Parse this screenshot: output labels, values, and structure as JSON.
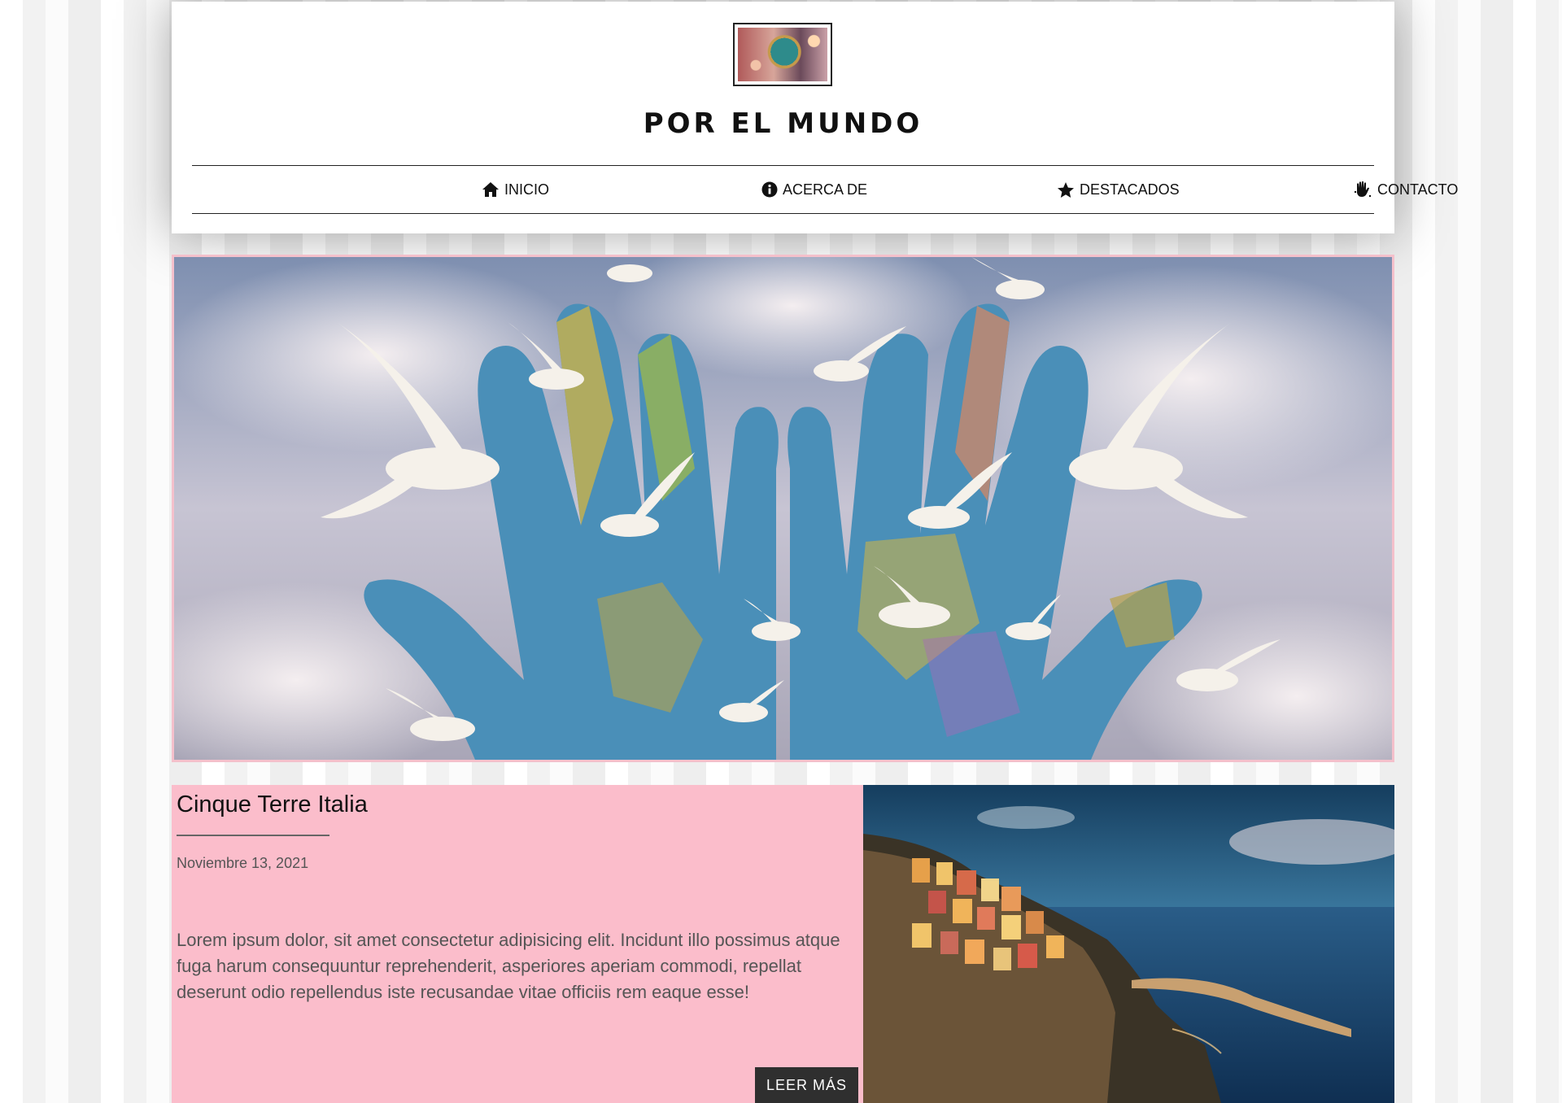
{
  "site": {
    "title": "POR EL MUNDO"
  },
  "nav": {
    "items": [
      {
        "label": "INICIO",
        "icon": "home-icon"
      },
      {
        "label": "ACERCA DE",
        "icon": "info-icon"
      },
      {
        "label": "DESTACADOS",
        "icon": "star-icon"
      },
      {
        "label": "CONTACTO",
        "icon": "hand-icon"
      }
    ]
  },
  "hero": {
    "image": "hands-world-map-doves"
  },
  "post": {
    "title": "Cinque Terre Italia",
    "date": "Noviembre 13, 2021",
    "excerpt": "Lorem ipsum dolor, sit amet consectetur adipisicing elit. Incidunt illo possimus atque fuga harum consequuntur reprehenderit, asperiores aperiam commodi, repellat deserunt odio repellendus iste recusandae vitae officiis rem eaque esse!",
    "read_more": "LEER MÁS",
    "image": "cinque-terre-coast-photo"
  },
  "colors": {
    "card_bg": "#fbbdcb",
    "hero_border": "#f4c0cb",
    "button_bg": "#2f2f2f"
  }
}
